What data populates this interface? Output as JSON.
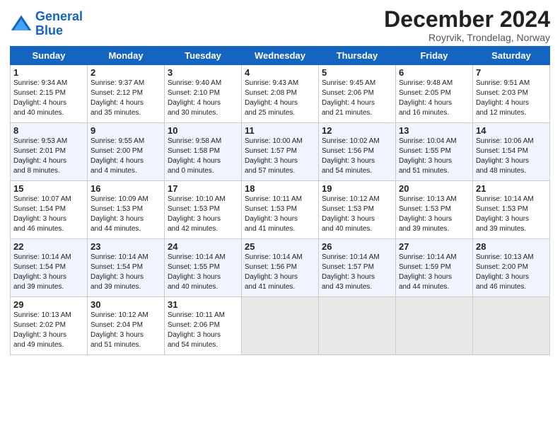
{
  "logo": {
    "line1": "General",
    "line2": "Blue"
  },
  "title": "December 2024",
  "subtitle": "Royrvik, Trondelag, Norway",
  "days_header": [
    "Sunday",
    "Monday",
    "Tuesday",
    "Wednesday",
    "Thursday",
    "Friday",
    "Saturday"
  ],
  "weeks": [
    [
      {
        "day": "1",
        "info": "Sunrise: 9:34 AM\nSunset: 2:15 PM\nDaylight: 4 hours\nand 40 minutes."
      },
      {
        "day": "2",
        "info": "Sunrise: 9:37 AM\nSunset: 2:12 PM\nDaylight: 4 hours\nand 35 minutes."
      },
      {
        "day": "3",
        "info": "Sunrise: 9:40 AM\nSunset: 2:10 PM\nDaylight: 4 hours\nand 30 minutes."
      },
      {
        "day": "4",
        "info": "Sunrise: 9:43 AM\nSunset: 2:08 PM\nDaylight: 4 hours\nand 25 minutes."
      },
      {
        "day": "5",
        "info": "Sunrise: 9:45 AM\nSunset: 2:06 PM\nDaylight: 4 hours\nand 21 minutes."
      },
      {
        "day": "6",
        "info": "Sunrise: 9:48 AM\nSunset: 2:05 PM\nDaylight: 4 hours\nand 16 minutes."
      },
      {
        "day": "7",
        "info": "Sunrise: 9:51 AM\nSunset: 2:03 PM\nDaylight: 4 hours\nand 12 minutes."
      }
    ],
    [
      {
        "day": "8",
        "info": "Sunrise: 9:53 AM\nSunset: 2:01 PM\nDaylight: 4 hours\nand 8 minutes."
      },
      {
        "day": "9",
        "info": "Sunrise: 9:55 AM\nSunset: 2:00 PM\nDaylight: 4 hours\nand 4 minutes."
      },
      {
        "day": "10",
        "info": "Sunrise: 9:58 AM\nSunset: 1:58 PM\nDaylight: 4 hours\nand 0 minutes."
      },
      {
        "day": "11",
        "info": "Sunrise: 10:00 AM\nSunset: 1:57 PM\nDaylight: 3 hours\nand 57 minutes."
      },
      {
        "day": "12",
        "info": "Sunrise: 10:02 AM\nSunset: 1:56 PM\nDaylight: 3 hours\nand 54 minutes."
      },
      {
        "day": "13",
        "info": "Sunrise: 10:04 AM\nSunset: 1:55 PM\nDaylight: 3 hours\nand 51 minutes."
      },
      {
        "day": "14",
        "info": "Sunrise: 10:06 AM\nSunset: 1:54 PM\nDaylight: 3 hours\nand 48 minutes."
      }
    ],
    [
      {
        "day": "15",
        "info": "Sunrise: 10:07 AM\nSunset: 1:54 PM\nDaylight: 3 hours\nand 46 minutes."
      },
      {
        "day": "16",
        "info": "Sunrise: 10:09 AM\nSunset: 1:53 PM\nDaylight: 3 hours\nand 44 minutes."
      },
      {
        "day": "17",
        "info": "Sunrise: 10:10 AM\nSunset: 1:53 PM\nDaylight: 3 hours\nand 42 minutes."
      },
      {
        "day": "18",
        "info": "Sunrise: 10:11 AM\nSunset: 1:53 PM\nDaylight: 3 hours\nand 41 minutes."
      },
      {
        "day": "19",
        "info": "Sunrise: 10:12 AM\nSunset: 1:53 PM\nDaylight: 3 hours\nand 40 minutes."
      },
      {
        "day": "20",
        "info": "Sunrise: 10:13 AM\nSunset: 1:53 PM\nDaylight: 3 hours\nand 39 minutes."
      },
      {
        "day": "21",
        "info": "Sunrise: 10:14 AM\nSunset: 1:53 PM\nDaylight: 3 hours\nand 39 minutes."
      }
    ],
    [
      {
        "day": "22",
        "info": "Sunrise: 10:14 AM\nSunset: 1:54 PM\nDaylight: 3 hours\nand 39 minutes."
      },
      {
        "day": "23",
        "info": "Sunrise: 10:14 AM\nSunset: 1:54 PM\nDaylight: 3 hours\nand 39 minutes."
      },
      {
        "day": "24",
        "info": "Sunrise: 10:14 AM\nSunset: 1:55 PM\nDaylight: 3 hours\nand 40 minutes."
      },
      {
        "day": "25",
        "info": "Sunrise: 10:14 AM\nSunset: 1:56 PM\nDaylight: 3 hours\nand 41 minutes."
      },
      {
        "day": "26",
        "info": "Sunrise: 10:14 AM\nSunset: 1:57 PM\nDaylight: 3 hours\nand 43 minutes."
      },
      {
        "day": "27",
        "info": "Sunrise: 10:14 AM\nSunset: 1:59 PM\nDaylight: 3 hours\nand 44 minutes."
      },
      {
        "day": "28",
        "info": "Sunrise: 10:13 AM\nSunset: 2:00 PM\nDaylight: 3 hours\nand 46 minutes."
      }
    ],
    [
      {
        "day": "29",
        "info": "Sunrise: 10:13 AM\nSunset: 2:02 PM\nDaylight: 3 hours\nand 49 minutes."
      },
      {
        "day": "30",
        "info": "Sunrise: 10:12 AM\nSunset: 2:04 PM\nDaylight: 3 hours\nand 51 minutes."
      },
      {
        "day": "31",
        "info": "Sunrise: 10:11 AM\nSunset: 2:06 PM\nDaylight: 3 hours\nand 54 minutes."
      },
      null,
      null,
      null,
      null
    ]
  ]
}
